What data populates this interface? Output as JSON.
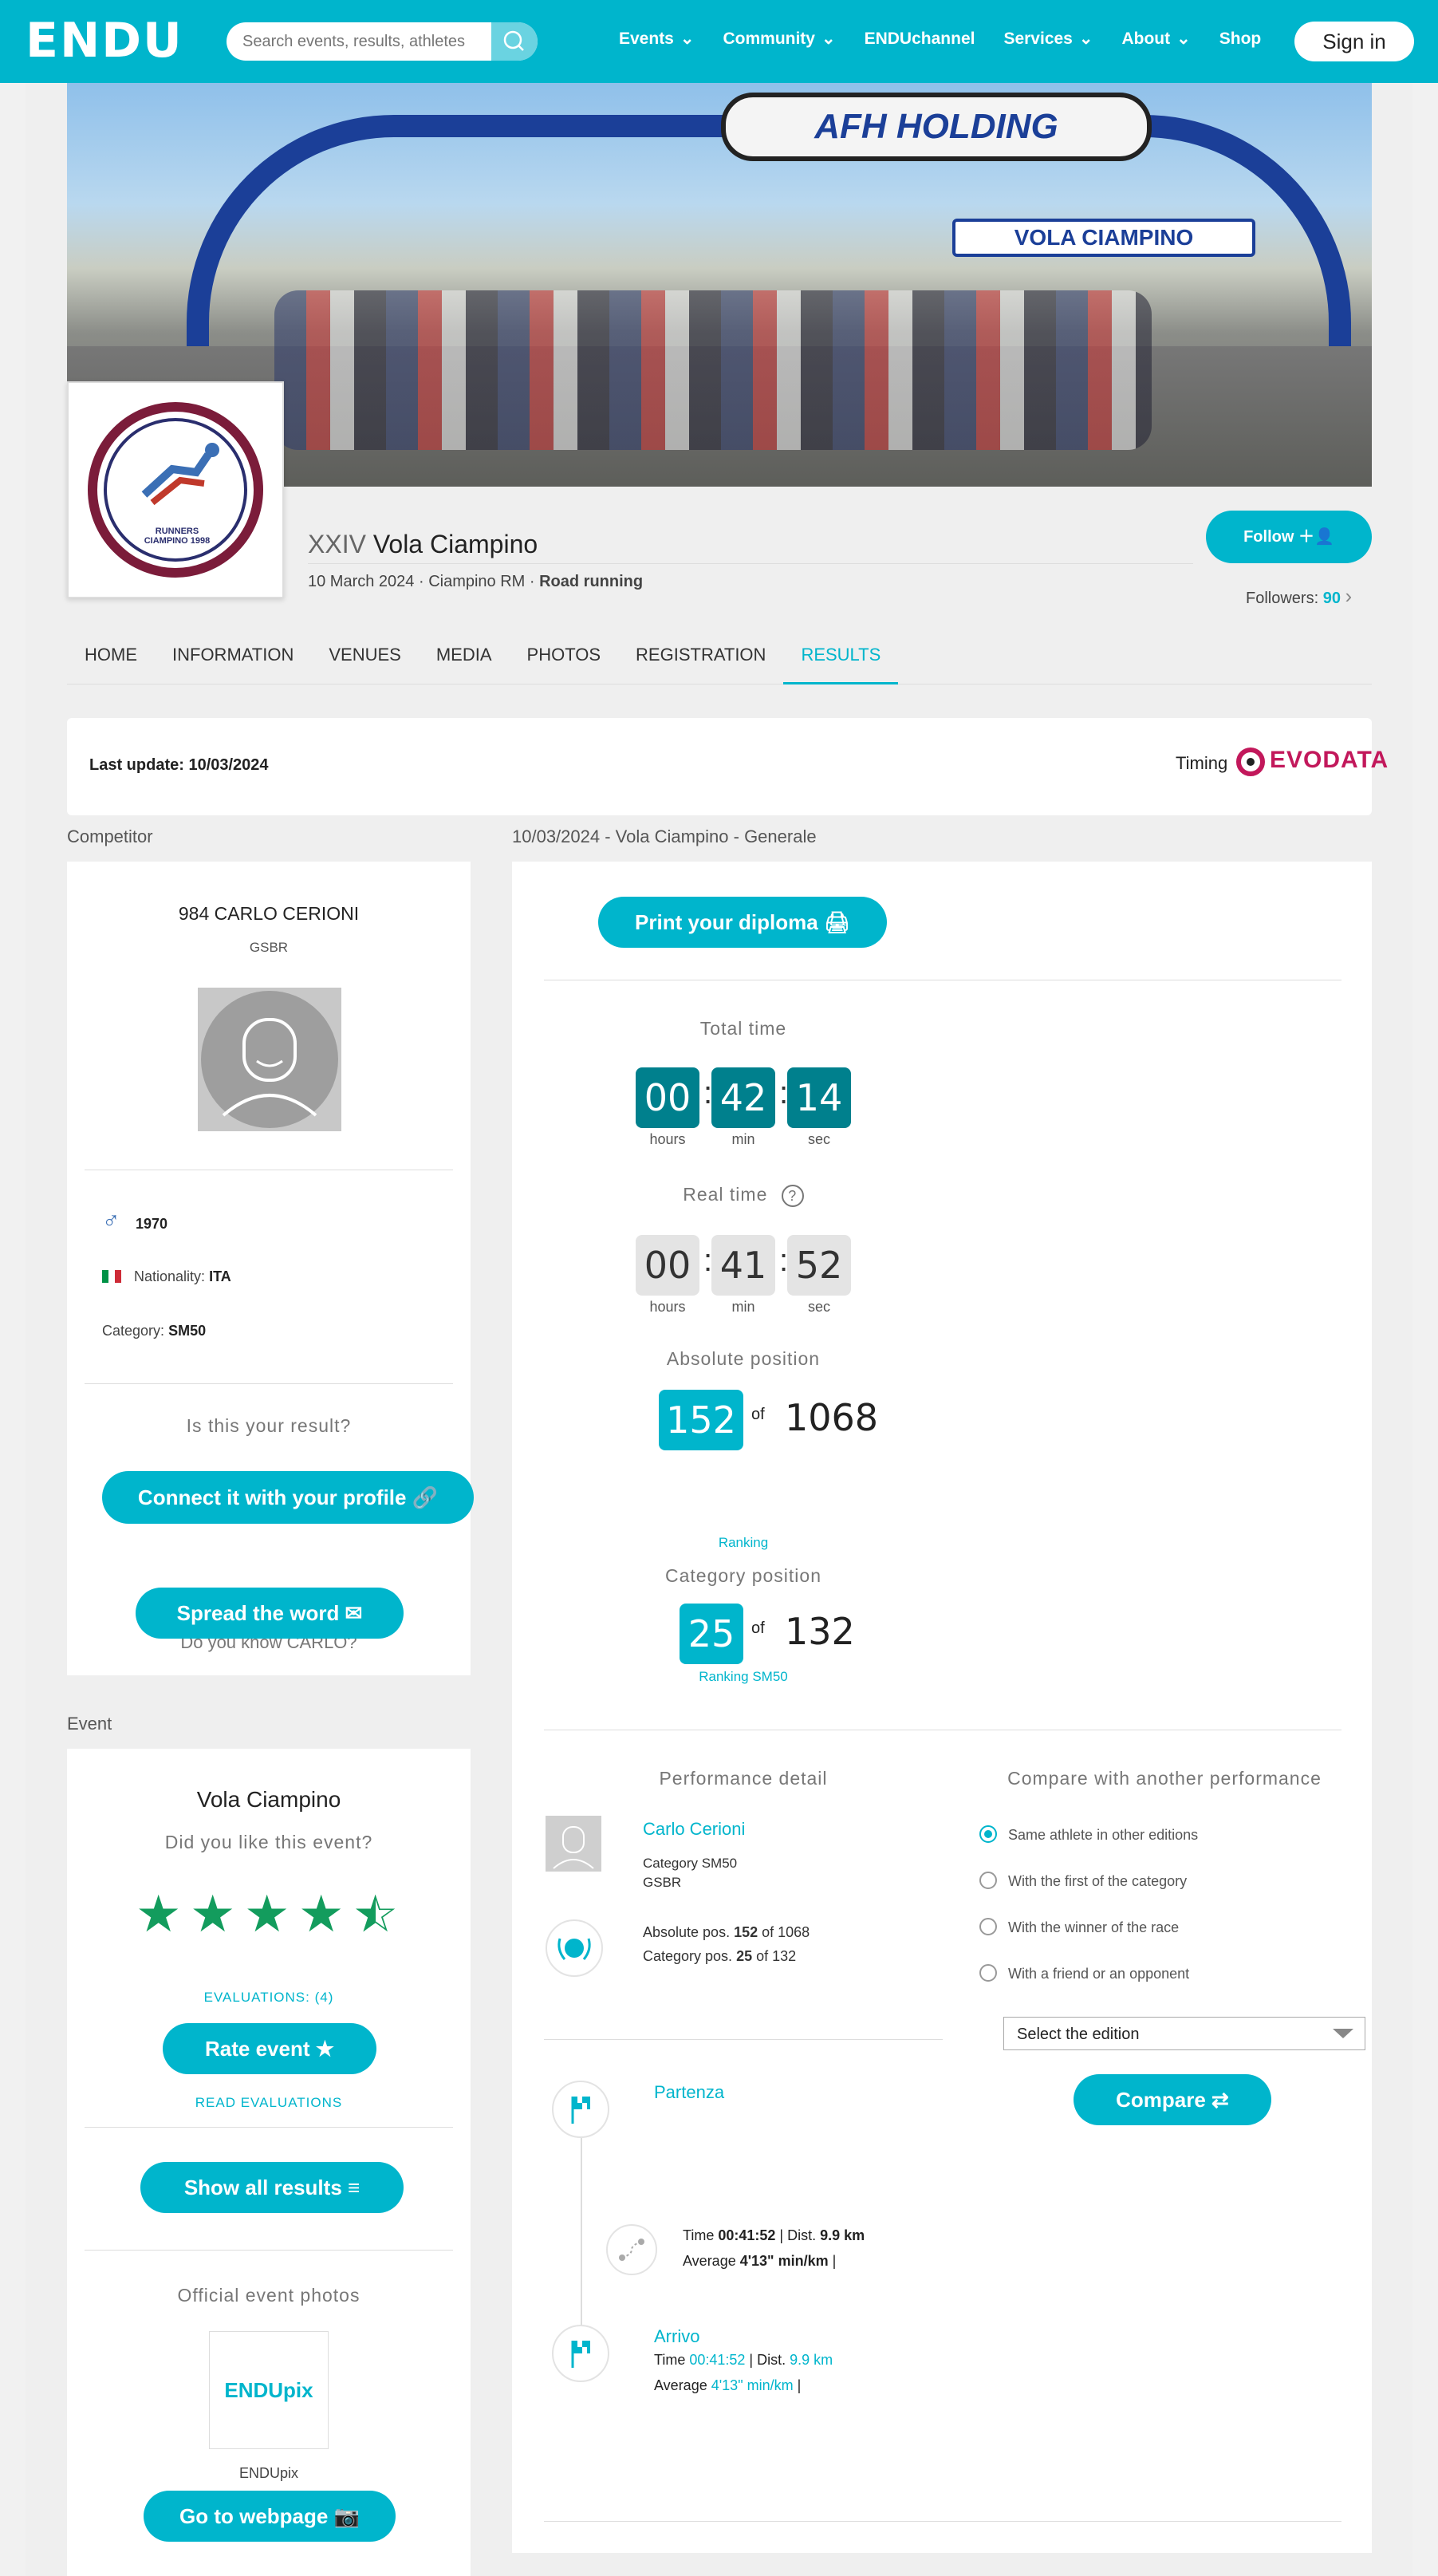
{
  "header": {
    "logo": "ENDU",
    "search_placeholder": "Search events, results, athletes",
    "nav": [
      "Events",
      "Community",
      "ENDUchannel",
      "Services",
      "About",
      "Shop"
    ],
    "signin": "Sign in"
  },
  "event": {
    "edition": "XXIV",
    "name": "Vola Ciampino",
    "date_place": "10 March 2024 · Ciampino RM · ",
    "type": "Road running",
    "follow": "Follow",
    "followers_label": "Followers:",
    "followers_count": "90",
    "club_logo_text": "RUNNERS CIAMPINO 1998",
    "hero_banner_top": "AFH HOLDING",
    "hero_banner_arch": "VOLA CIAMPINO"
  },
  "tabs": [
    "HOME",
    "INFORMATION",
    "VENUES",
    "MEDIA",
    "PHOTOS",
    "REGISTRATION",
    "RESULTS"
  ],
  "update": {
    "last_update": "Last update: 10/03/2024",
    "timing": "Timing",
    "timing_logo": "EVODATA"
  },
  "competitor": {
    "section": "Competitor",
    "name": "984 CARLO CERIONI",
    "club": "GSBR",
    "birth_year": "1970",
    "nationality_label": "Nationality:",
    "nationality": "ITA",
    "category_label": "Category:",
    "category": "SM50",
    "is_yours": "Is this your result?",
    "connect": "Connect it with your profile 🔗",
    "know": "Do you know CARLO?",
    "spread": "Spread the word ✉"
  },
  "event_card": {
    "section": "Event",
    "name": "Vola Ciampino",
    "like": "Did you like this event?",
    "rating": 4.5,
    "evaluations": "EVALUATIONS: (4)",
    "rate": "Rate event ★",
    "read": "READ EVALUATIONS",
    "show_all": "Show all results ≡",
    "photos_title": "Official event photos",
    "photos_brand": "ENDUpix",
    "photos_caption": "ENDUpix",
    "goto": "Go to webpage 📷"
  },
  "results": {
    "section": "10/03/2024 - Vola Ciampino - Generale",
    "diploma": "Print your diploma 🖨",
    "total_time_label": "Total time",
    "total": {
      "h": "00",
      "m": "42",
      "s": "14"
    },
    "real_time_label": "Real time",
    "real": {
      "h": "00",
      "m": "41",
      "s": "52"
    },
    "hours": "hours",
    "min": "min",
    "sec": "sec",
    "abs_label": "Absolute position",
    "abs_pos": "152",
    "of": "of",
    "abs_total": "1068",
    "ranking": "Ranking",
    "cat_label": "Category position",
    "cat_pos": "25",
    "cat_total": "132",
    "ranking_cat": "Ranking SM50",
    "perf_title": "Performance detail",
    "athlete": "Carlo Cerioni",
    "athlete_cat": "Category SM50",
    "athlete_club": "GSBR",
    "abs_line_pre": "Absolute pos. ",
    "abs_line_num": "152",
    "abs_line_post": " of 1068",
    "cat_line_pre": "Category pos. ",
    "cat_line_num": "25",
    "cat_line_post": " of 132",
    "compare_title": "Compare with another performance",
    "compare_options": [
      "Same athlete in other editions",
      "With the first of the category",
      "With the winner of the race",
      "With a friend or an opponent"
    ],
    "select_edition": "Select the edition",
    "compare_btn": "Compare ⇄",
    "start": "Partenza",
    "split_time_label": "Time ",
    "split_time": "00:41:52",
    "split_dist_label": " | Dist. ",
    "split_dist": "9.9 km",
    "split_avg_label": "Average ",
    "split_avg": "4'13\" min/km",
    "split_tail": " |",
    "finish": "Arrivo",
    "finish_time": "00:41:52",
    "finish_dist": "9.9 km",
    "finish_avg": "4'13\" min/km"
  }
}
